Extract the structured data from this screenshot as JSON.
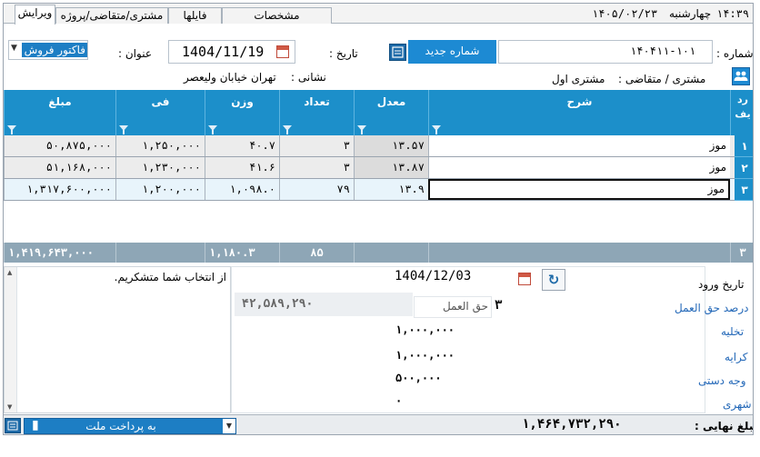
{
  "tabs": [
    "ویرایش",
    "مشتری/متقاضی/پروژه",
    "فایلها",
    "مشخصات"
  ],
  "datetime": {
    "time": "۱۴:۳۹",
    "weekday": "چهارشنبه",
    "date": "۱۴۰۵/۰۲/۲۳"
  },
  "header": {
    "number_label": "شماره :",
    "number_value": "۱۴۰۴۱۱-۱۰۱",
    "new_number_button": "شماره جدید",
    "date_label": "تاریخ :",
    "date_value": "1404/11/19",
    "title_label": "عنوان :",
    "title_value": "فاکتور فروش",
    "customer_label": "مشتری / متقاضی :",
    "customer_value": "مشتری اول",
    "address_label": "نشانی :",
    "address_value": "تهران خیابان ولیعصر"
  },
  "grid": {
    "columns": {
      "radif": "رد یف",
      "sharh": "شرح",
      "moadel": "معدل",
      "tedad": "تعداد",
      "vazn": "وزن",
      "fi": "فی",
      "mablagh": "مبلغ"
    },
    "rows": [
      {
        "num": "۱",
        "sharh": "موز",
        "moadel": "۱۳.۵۷",
        "tedad": "۳",
        "vazn": "۴۰.۷",
        "fi": "۱,۲۵۰,۰۰۰",
        "mablagh": "۵۰,۸۷۵,۰۰۰"
      },
      {
        "num": "۲",
        "sharh": "موز",
        "moadel": "۱۳.۸۷",
        "tedad": "۳",
        "vazn": "۴۱.۶",
        "fi": "۱,۲۳۰,۰۰۰",
        "mablagh": "۵۱,۱۶۸,۰۰۰"
      },
      {
        "num": "۳",
        "sharh": "موز",
        "moadel": "۱۳.۹",
        "tedad": "۷۹",
        "vazn": "۱,۰۹۸.۰",
        "fi": "۱,۲۰۰,۰۰۰",
        "mablagh": "۱,۳۱۷,۶۰۰,۰۰۰"
      }
    ],
    "totals": {
      "count": "۳",
      "tedad": "۸۵",
      "vazn": "۱,۱۸۰.۳",
      "mablagh": "۱,۴۱۹,۶۴۳,۰۰۰"
    }
  },
  "details": {
    "entry_date_label": "تاریخ ورود",
    "entry_date_value": "1404/12/03",
    "commission_percent_label": "درصد حق العمل",
    "commission_percent_value": "۳",
    "commission_label": "حق العمل",
    "commission_amount": "۴۲,۵۸۹,۲۹۰",
    "unloading_label": "تخلیه",
    "unloading_value": "۱,۰۰۰,۰۰۰",
    "rent_label": "کرایه",
    "rent_value": "۱,۰۰۰,۰۰۰",
    "hand_fee_label": "وجه دستی",
    "hand_fee_value": "۵۰۰,۰۰۰",
    "municipal_label": "شهری",
    "municipal_value": "۰",
    "notes": "از انتخاب شما متشکریم."
  },
  "footer": {
    "final_label": "مبلغ نهایی :",
    "final_value": "۱,۴۶۴,۷۳۲,۲۹۰",
    "payment_value": "به پرداخت ملت"
  },
  "colors": {
    "header_blue": "#1c8fca",
    "totals_gray": "#8ea6b6",
    "link_blue": "#2368b8"
  }
}
